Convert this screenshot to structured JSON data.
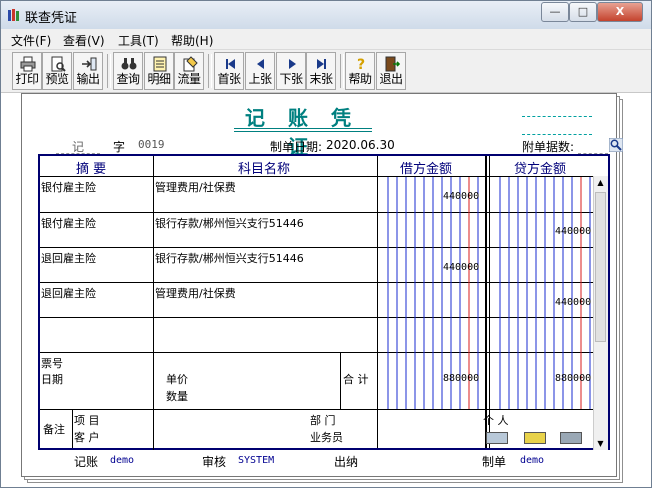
{
  "window": {
    "title": "联查凭证",
    "minimize": "—",
    "maximize": "□",
    "close": "X"
  },
  "menu": [
    "文件(F)",
    "查看(V)",
    "工具(T)",
    "帮助(H)"
  ],
  "toolbar": {
    "print": "打印",
    "preview": "预览",
    "export": "输出",
    "query": "查询",
    "detail": "明细",
    "flow": "流量",
    "first": "首张",
    "prev": "上张",
    "next": "下张",
    "last": "末张",
    "help": "帮助",
    "exit": "退出"
  },
  "voucher": {
    "title": "记 账 凭 证",
    "type": "记",
    "number_label": "字",
    "number": "0019",
    "date_label": "制单日期:",
    "date": "2020.06.30",
    "attachments_label": "附单据数:",
    "columns": {
      "summary": "摘 要",
      "account": "科目名称",
      "debit": "借方金额",
      "credit": "贷方金额"
    },
    "entries": [
      {
        "summary": "银付雇主险",
        "account": "管理费用/社保费",
        "debit": "440000",
        "credit": ""
      },
      {
        "summary": "银付雇主险",
        "account": "银行存款/郴州恒兴支行51446",
        "debit": "",
        "credit": "440000"
      },
      {
        "summary": "退回雇主险",
        "account": "银行存款/郴州恒兴支行51446",
        "debit": "440000",
        "credit": ""
      },
      {
        "summary": "退回雇主险",
        "account": "管理费用/社保费",
        "debit": "",
        "credit": "440000"
      }
    ],
    "bill_no_label": "票号",
    "date_row_label": "日期",
    "unit_price_label": "单价",
    "quantity_label": "数量",
    "total_label": "合 计",
    "total_debit": "880000",
    "total_credit": "880000",
    "remarks_label": "备注",
    "project_label": "项 目",
    "department_label": "部 门",
    "person_label": "个 人",
    "customer_label": "客 户",
    "salesman_label": "业务员",
    "posting_label": "记账",
    "posting_user": "demo",
    "review_label": "审核",
    "review_user": "SYSTEM",
    "cashier_label": "出纳",
    "maker_label": "制单",
    "maker_user": "demo"
  },
  "colors": {
    "title": "#008080",
    "header": "#00007a",
    "debit_line": "#1a2bd0",
    "unit_line": "#d81b1b"
  }
}
